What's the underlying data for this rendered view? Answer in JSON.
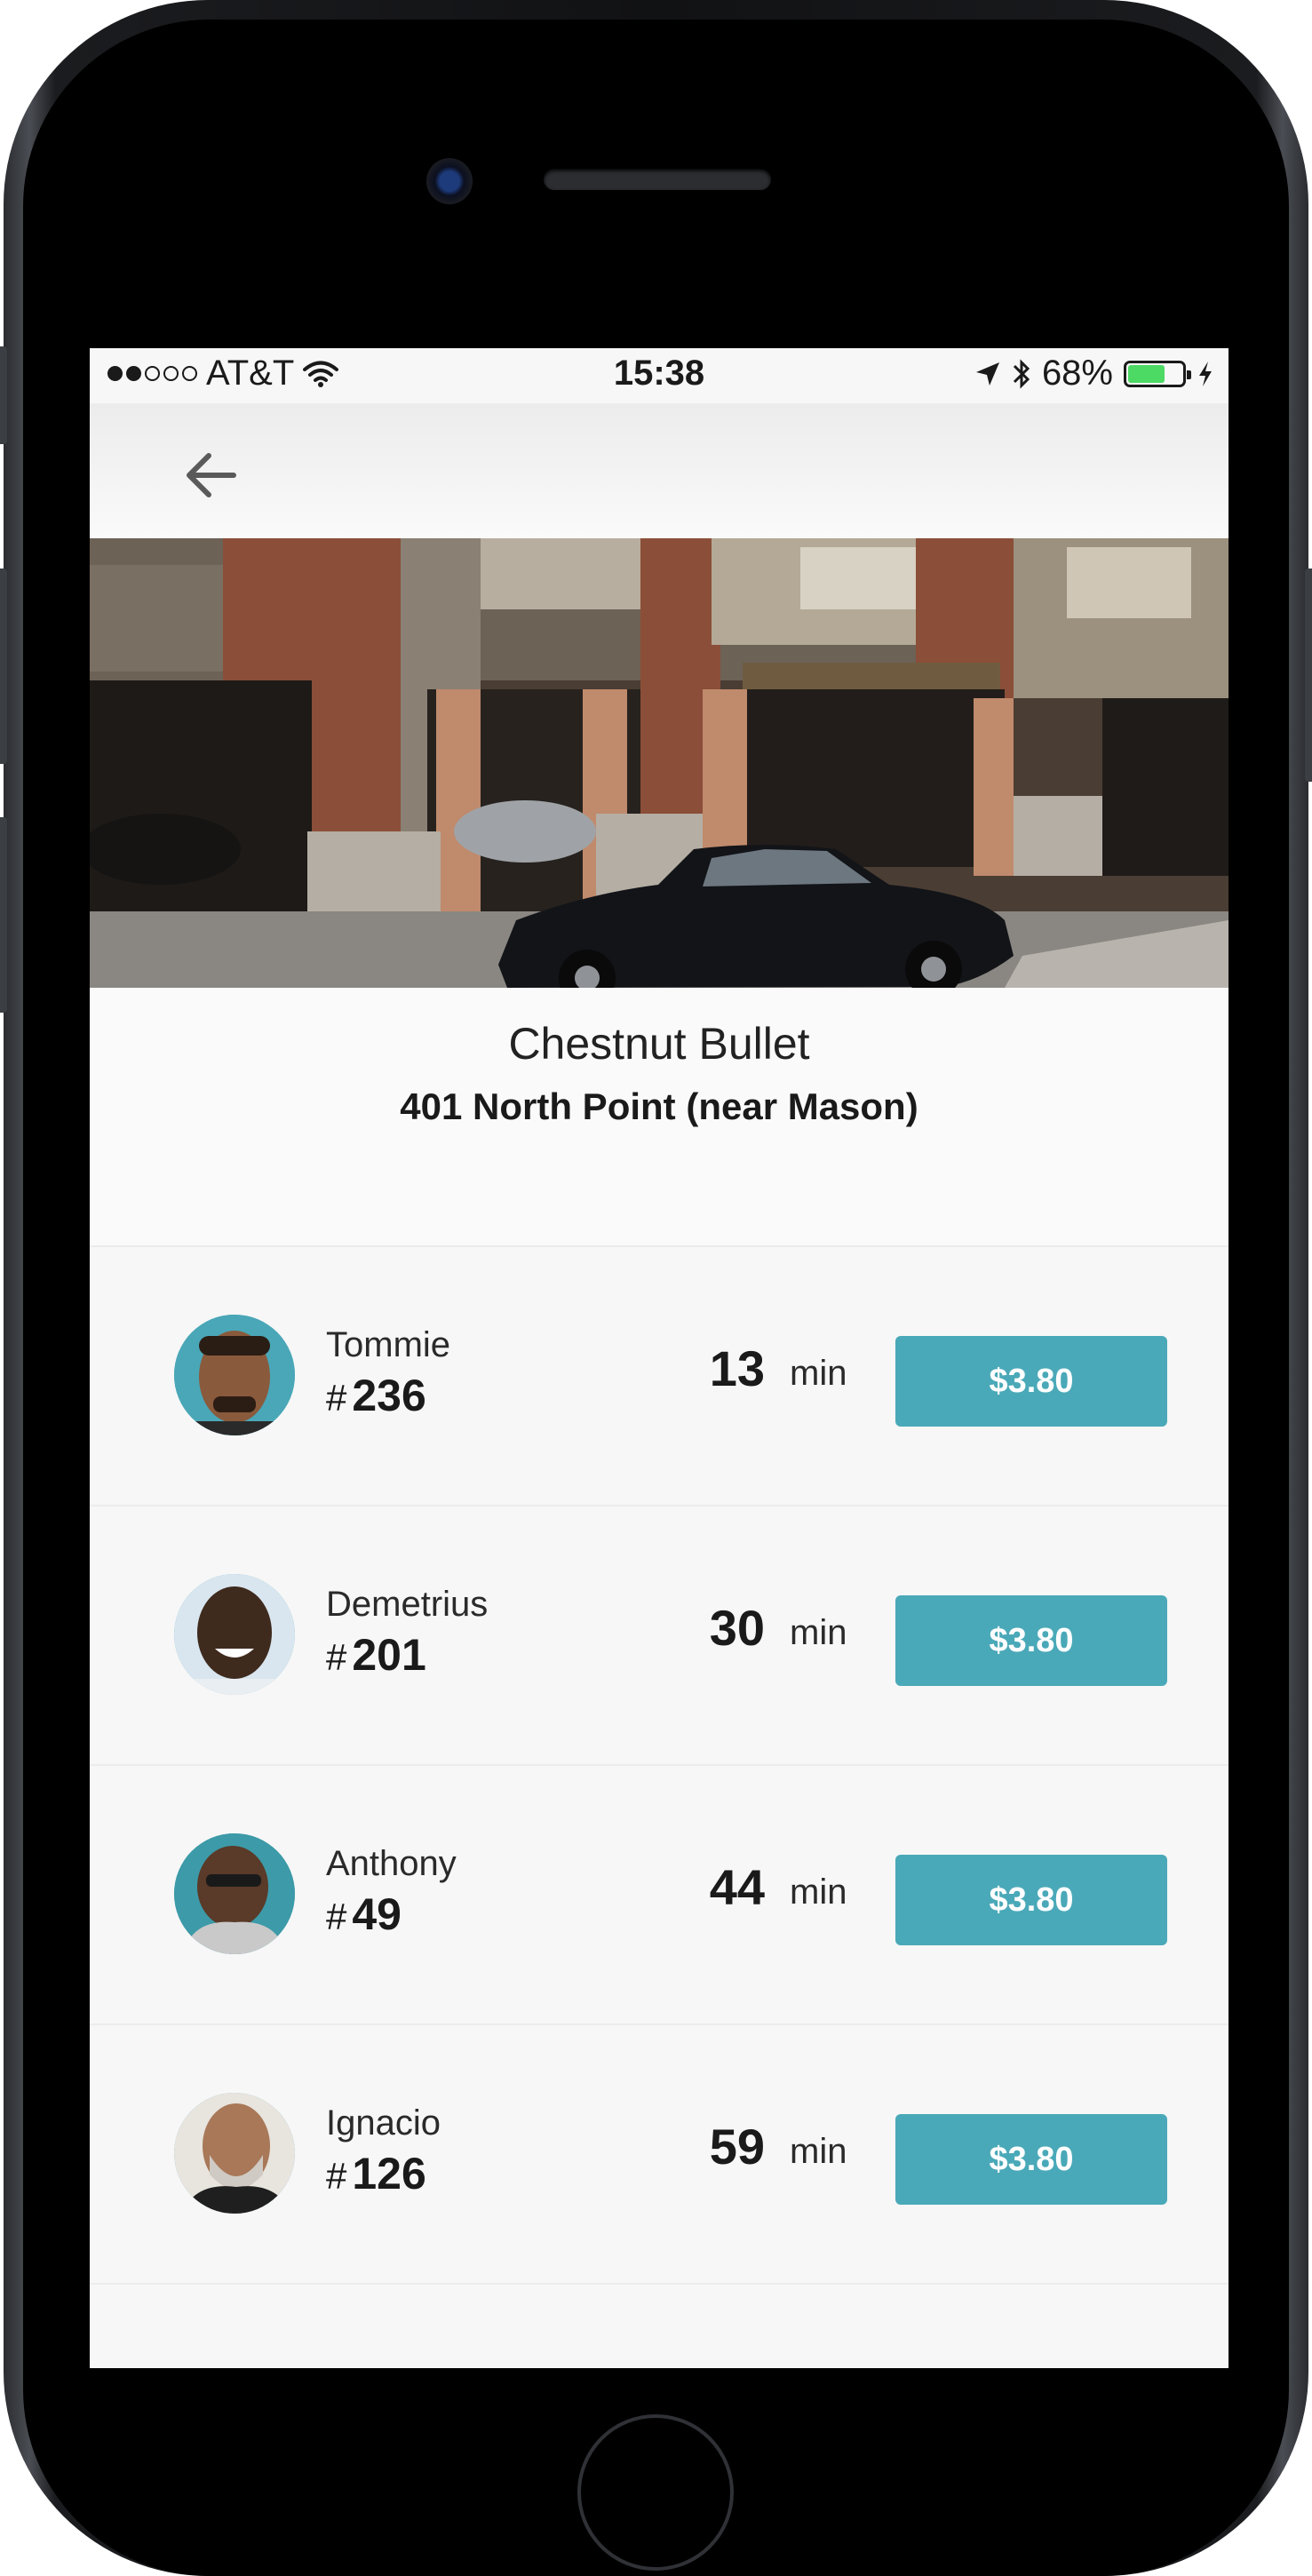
{
  "status_bar": {
    "carrier": "AT&T",
    "time": "15:38",
    "battery_percent": "68%",
    "battery_level": 0.68,
    "signal_bars_filled": 2
  },
  "nav": {
    "back_icon": "arrow-left-icon"
  },
  "place": {
    "name": "Chestnut Bullet",
    "address": "401 North Point (near Mason)"
  },
  "drivers": [
    {
      "name": "Tommie",
      "hash": "#",
      "number": "236",
      "eta": "13",
      "unit": "min",
      "price": "$3.80"
    },
    {
      "name": "Demetrius",
      "hash": "#",
      "number": "201",
      "eta": "30",
      "unit": "min",
      "price": "$3.80"
    },
    {
      "name": "Anthony",
      "hash": "#",
      "number": "49",
      "eta": "44",
      "unit": "min",
      "price": "$3.80"
    },
    {
      "name": "Ignacio",
      "hash": "#",
      "number": "126",
      "eta": "59",
      "unit": "min",
      "price": "$3.80"
    }
  ],
  "colors": {
    "accent": "#4aa9b8",
    "background": "#f7f7f7"
  }
}
